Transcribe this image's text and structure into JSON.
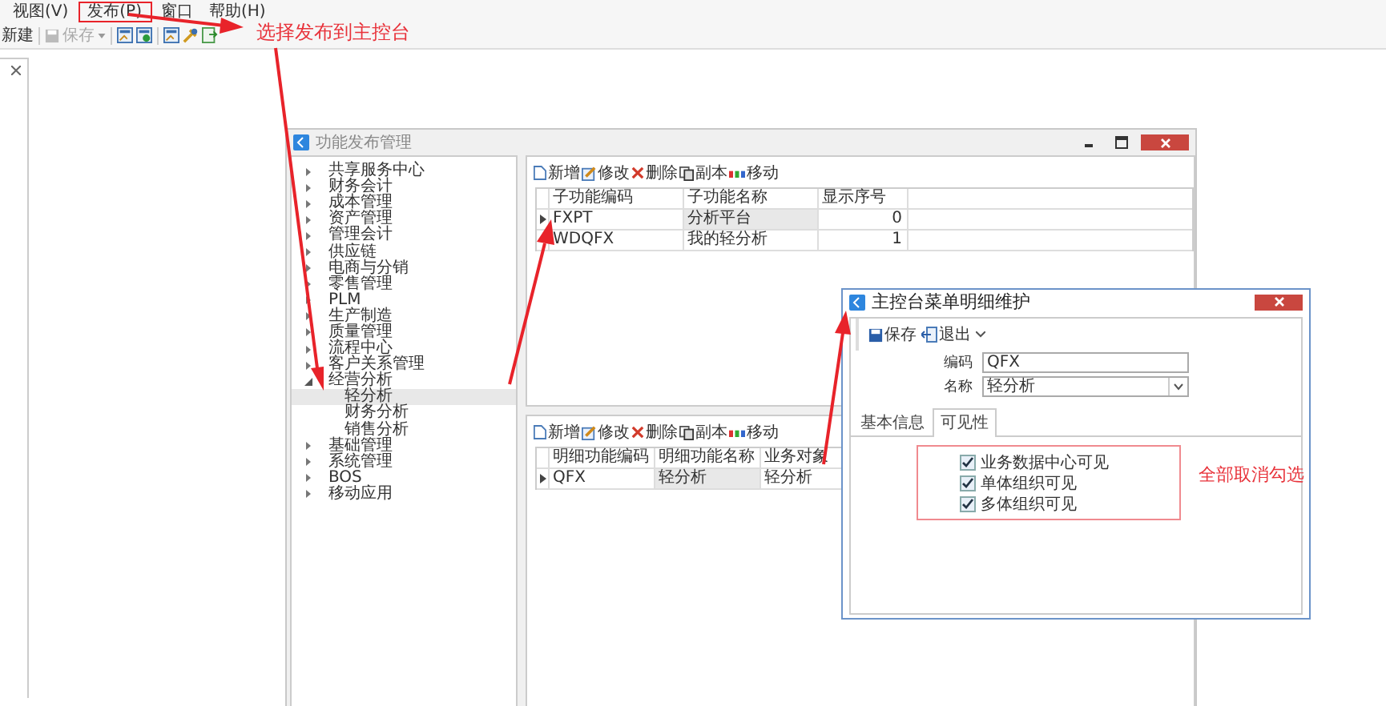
{
  "menu_bar": [
    {
      "label": "视图(V)",
      "annotated": false
    },
    {
      "label": "发布(P)",
      "annotated": true
    },
    {
      "label": "窗口",
      "annotated": false
    },
    {
      "label": "帮助(H)",
      "annotated": false
    }
  ],
  "toolbar": [
    {
      "kind": "new",
      "label": "新建",
      "disabled": false
    },
    {
      "kind": "save",
      "label": "保存",
      "disabled": true
    }
  ],
  "annotations": [
    {
      "text": "选择发布到主控台"
    },
    {
      "text": "全部取消勾选"
    }
  ],
  "main_window": {
    "title": "功能发布管理",
    "tree": [
      {
        "label": "共享服务中心",
        "expanded": false,
        "selected": false
      },
      {
        "label": "财务会计",
        "expanded": false,
        "selected": false
      },
      {
        "label": "成本管理",
        "expanded": false,
        "selected": false
      },
      {
        "label": "资产管理",
        "expanded": false,
        "selected": false
      },
      {
        "label": "管理会计",
        "expanded": false,
        "selected": false
      },
      {
        "label": "供应链",
        "expanded": false,
        "selected": false
      },
      {
        "label": "电商与分销",
        "expanded": false,
        "selected": false
      },
      {
        "label": "零售管理",
        "expanded": false,
        "selected": false
      },
      {
        "label": "PLM",
        "expanded": false,
        "selected": false
      },
      {
        "label": "生产制造",
        "expanded": false,
        "selected": false
      },
      {
        "label": "质量管理",
        "expanded": false,
        "selected": false
      },
      {
        "label": "流程中心",
        "expanded": false,
        "selected": false
      },
      {
        "label": "客户关系管理",
        "expanded": false,
        "selected": false
      },
      {
        "label": "经营分析",
        "expanded": true,
        "selected": false,
        "children": [
          {
            "label": "轻分析",
            "selected": true
          },
          {
            "label": "财务分析",
            "selected": false
          },
          {
            "label": "销售分析",
            "selected": false
          }
        ]
      },
      {
        "label": "基础管理",
        "expanded": false,
        "selected": false
      },
      {
        "label": "系统管理",
        "expanded": false,
        "selected": false
      },
      {
        "label": "BOS",
        "expanded": false,
        "selected": false
      },
      {
        "label": "移动应用",
        "expanded": false,
        "selected": false
      }
    ],
    "upper_toolbar": [
      {
        "kind": "new",
        "label": "新增"
      },
      {
        "kind": "edit",
        "label": "修改"
      },
      {
        "kind": "delete",
        "label": "删除"
      },
      {
        "kind": "copy",
        "label": "副本"
      },
      {
        "kind": "move",
        "label": "移动"
      }
    ],
    "upper_grid": {
      "columns": [
        "子功能编码",
        "子功能名称",
        "显示序号"
      ],
      "rows": [
        {
          "cells": [
            "FXPT",
            "分析平台",
            "0"
          ],
          "current": true
        },
        {
          "cells": [
            "WDQFX",
            "我的轻分析",
            "1"
          ],
          "current": false
        }
      ]
    },
    "lower_toolbar": [
      {
        "kind": "new",
        "label": "新增"
      },
      {
        "kind": "edit",
        "label": "修改"
      },
      {
        "kind": "delete",
        "label": "删除"
      },
      {
        "kind": "copy",
        "label": "副本"
      },
      {
        "kind": "move",
        "label": "移动"
      }
    ],
    "lower_grid": {
      "columns": [
        "明细功能编码",
        "明细功能名称",
        "业务对象"
      ],
      "rows": [
        {
          "cells": [
            "QFX",
            "轻分析",
            "轻分析"
          ],
          "current": true
        }
      ]
    }
  },
  "dialog": {
    "title": "主控台菜单明细维护",
    "toolbar": [
      {
        "kind": "save",
        "label": "保存"
      },
      {
        "kind": "exit",
        "label": "退出"
      }
    ],
    "fields": [
      {
        "kind": "text",
        "label": "编码",
        "value": "QFX"
      },
      {
        "kind": "select",
        "label": "名称",
        "value": "轻分析"
      }
    ],
    "tabs": [
      {
        "label": "基本信息",
        "selected": false
      },
      {
        "label": "可见性",
        "selected": true
      }
    ],
    "checkboxes": [
      {
        "label": "业务数据中心可见",
        "checked": true
      },
      {
        "label": "单体组织可见",
        "checked": true
      },
      {
        "label": "多体组织可见",
        "checked": true
      }
    ]
  }
}
